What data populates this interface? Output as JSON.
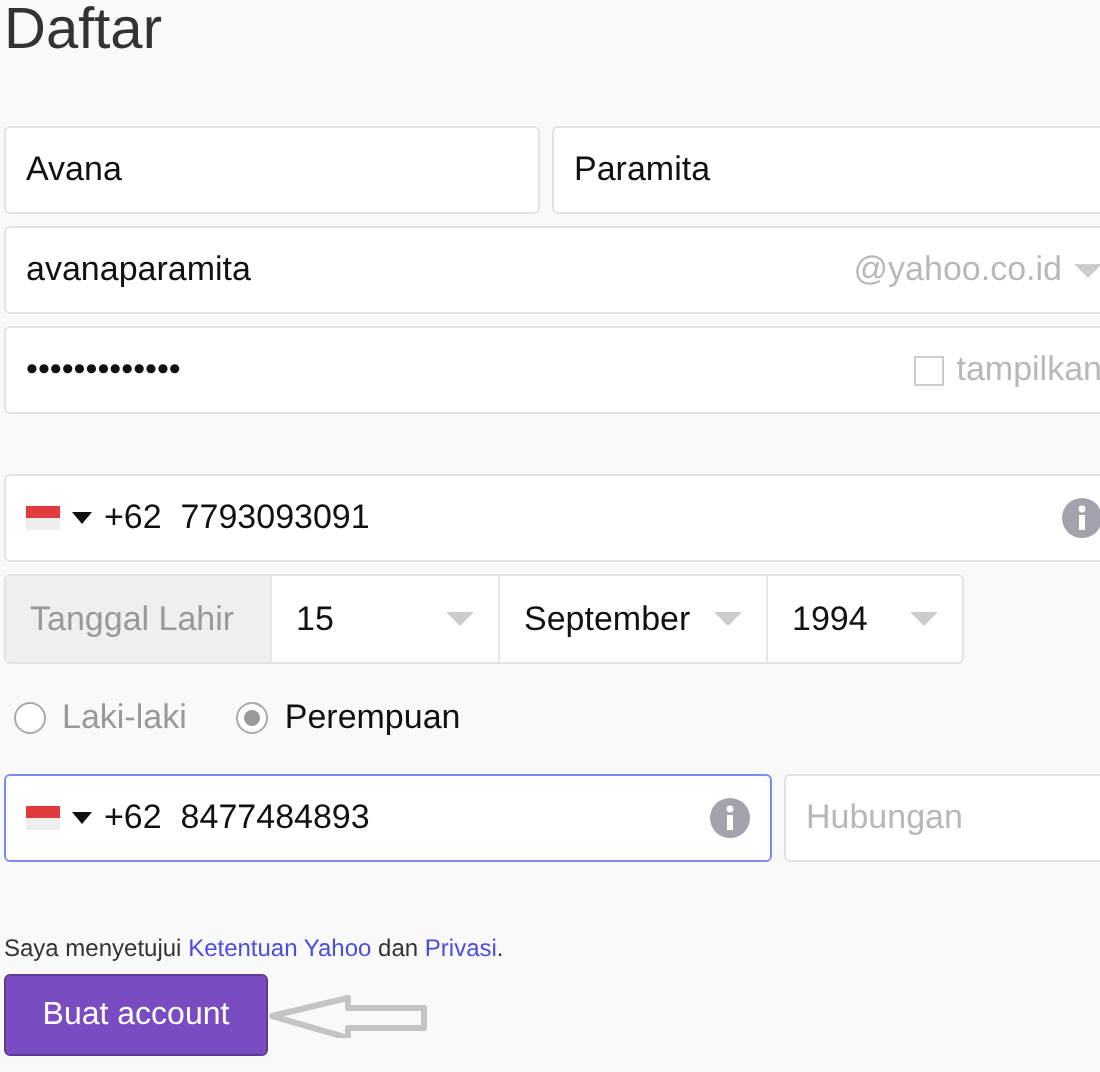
{
  "title": "Daftar",
  "first_name": {
    "value": "Avana"
  },
  "last_name": {
    "value": "Paramita"
  },
  "username": {
    "value": "avanaparamita",
    "suffix": "@yahoo.co.id"
  },
  "password": {
    "value": "•••••••••••••",
    "show_label": "tampilkan",
    "show_checked": false
  },
  "phone": {
    "code": "+62",
    "number": "7793093091"
  },
  "birth": {
    "label": "Tanggal Lahir",
    "day": "15",
    "month": "September",
    "year": "1994"
  },
  "gender": [
    {
      "label": "Laki-laki",
      "selected": false
    },
    {
      "label": "Perempuan",
      "selected": true
    }
  ],
  "recovery_phone": {
    "code": "+62",
    "number": "8477484893",
    "focused": true
  },
  "relationship": {
    "placeholder": "Hubungan"
  },
  "terms": [
    {
      "kind": "text",
      "text": "Saya menyetujui "
    },
    {
      "kind": "link",
      "text": "Ketentuan Yahoo"
    },
    {
      "kind": "text",
      "text": " dan "
    },
    {
      "kind": "link",
      "text": "Privasi"
    },
    {
      "kind": "text",
      "text": "."
    }
  ],
  "submit": "Buat account"
}
